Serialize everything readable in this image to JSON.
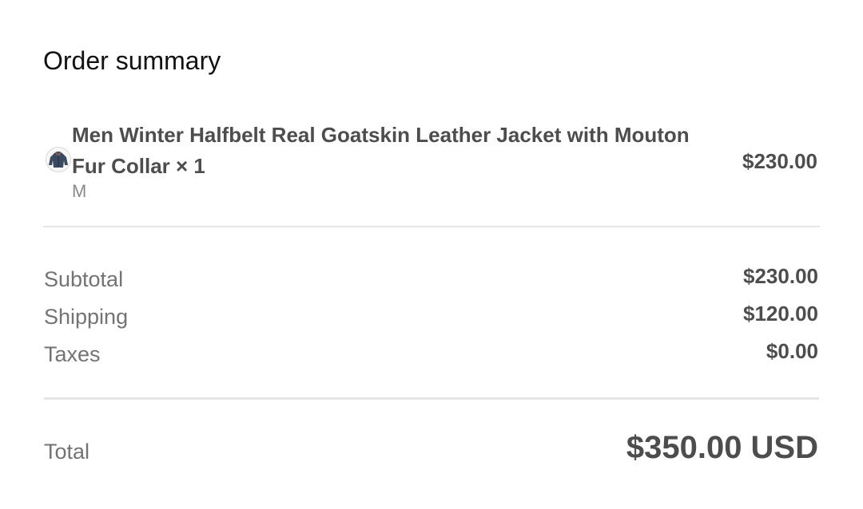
{
  "order_summary": {
    "title": "Order summary",
    "item": {
      "image_icon": "jacket-thumbnail",
      "name_line": "Men Winter Halfbelt Real Goatskin Leather Jacket with Mouton Fur Collar × 1",
      "variant": "M",
      "price": "$230.00"
    },
    "rows": [
      {
        "label": "Subtotal",
        "value": "$230.00"
      },
      {
        "label": "Shipping",
        "value": "$120.00"
      },
      {
        "label": "Taxes",
        "value": "$0.00"
      }
    ],
    "total": {
      "label": "Total",
      "value": "$350.00 USD"
    }
  }
}
